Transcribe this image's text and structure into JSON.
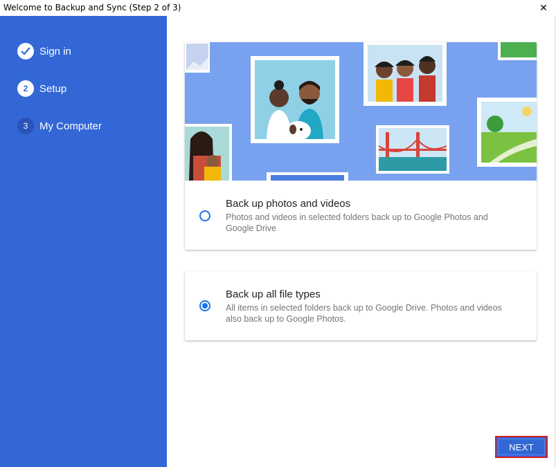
{
  "window": {
    "title": "Welcome to Backup and Sync (Step 2 of 3)",
    "close_glyph": "✕"
  },
  "sidebar": {
    "steps": [
      {
        "number": "",
        "label": "Sign in",
        "state": "done",
        "icon": "check-icon"
      },
      {
        "number": "2",
        "label": "Setup",
        "state": "active"
      },
      {
        "number": "3",
        "label": "My Computer",
        "state": "pending"
      }
    ]
  },
  "options": [
    {
      "title": "Back up photos and videos",
      "description": "Photos and videos in selected folders back up to Google Photos and Google Drive",
      "selected": false
    },
    {
      "title": "Back up all file types",
      "description": "All items in selected folders back up to Google Drive. Photos and videos also back up to Google Photos.",
      "selected": true
    }
  ],
  "footer": {
    "next_label": "NEXT"
  },
  "colors": {
    "sidebar": "#3367d6",
    "accent": "#1a73e8",
    "illustration_bg": "#78a2f0",
    "highlight_border": "#d91c1c"
  }
}
